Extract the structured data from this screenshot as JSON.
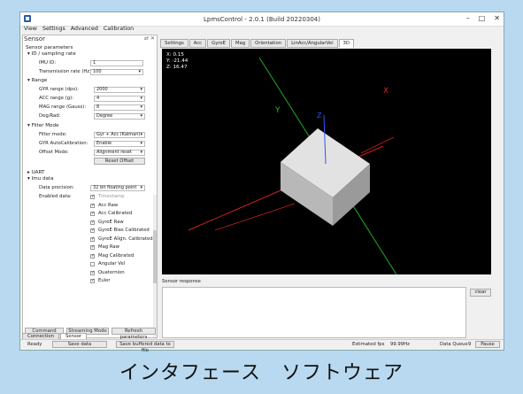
{
  "window": {
    "title": "LpmsControl - 2.0.1 (Build 20220304)"
  },
  "menu": [
    "View",
    "Settings",
    "Advanced",
    "Calibration"
  ],
  "sensor_panel": {
    "title": "Sensor",
    "header_buttons": "⇄ ✕",
    "root_label": "Sensor parameters",
    "id_section": "▾ ID / sampling rate",
    "imu_id_label": "IMU ID:",
    "imu_id_value": "1",
    "tx_rate_label": "Transmission rate (Hz):",
    "tx_rate_value": "100",
    "range_section": "▾ Range",
    "gyr_label": "GYR range (dps):",
    "gyr_value": "2000",
    "acc_label": "ACC range (g):",
    "acc_value": "4",
    "mag_label": "MAG range (Gauss):",
    "mag_value": "8",
    "deg_label": "Deg/Rad:",
    "deg_value": "Degree",
    "filter_section": "▾ Filter Mode",
    "filter_label": "Filter mode:",
    "filter_value": "Gyr + Acc (Kalman)",
    "gyr_auto_label": "GYR AutoCalibration:",
    "gyr_auto_value": "Enable",
    "offset_label": "Offset Mode:",
    "offset_value": "Alignment reset",
    "reset_offset": "Reset Offset",
    "uart_section": "▸ UART",
    "imu_data_section": "▾ Imu data",
    "precision_label": "Data precision:",
    "precision_value": "32 bit floating point",
    "enabled_label": "Enabled data:",
    "enabled_items": [
      {
        "label": "Timestamp",
        "checked": true,
        "dim": true
      },
      {
        "label": "Acc Raw",
        "checked": true
      },
      {
        "label": "Acc Calibrated",
        "checked": true
      },
      {
        "label": "GyroE Raw",
        "checked": true
      },
      {
        "label": "GyroE Bias Calibrated",
        "checked": true
      },
      {
        "label": "GyroE Align. Calibrated",
        "checked": true
      },
      {
        "label": "Mag Raw",
        "checked": true
      },
      {
        "label": "Mag Calibrated",
        "checked": true
      },
      {
        "label": "Angular Vel",
        "checked": false
      },
      {
        "label": "Quaternion",
        "checked": true
      },
      {
        "label": "Euler",
        "checked": true
      }
    ],
    "btn_command": "Command Mode",
    "btn_streaming": "Streaming Mode",
    "btn_refresh": "Refresh parameters"
  },
  "left_tabs": [
    "Connection",
    "Sensor"
  ],
  "top_tabs": [
    "Settings",
    "Acc",
    "GyroE",
    "Mag",
    "Orientation",
    "LinAcc/AngularVel",
    "3D"
  ],
  "viewport": {
    "x_label": "X: 0.15",
    "y_label": "Y: -21.44",
    "z_label": "Z: 16.47",
    "axis_x": "X",
    "axis_y": "Y",
    "axis_z": "Z",
    "color_x": "#e02020",
    "color_y": "#20c020",
    "color_z": "#3050ff"
  },
  "response": {
    "label": "Sensor response",
    "clear": "clear"
  },
  "status": {
    "ready": "Ready",
    "save_data": "Save data",
    "save_buffered": "Save buffered data to file",
    "fps_label": "Estimated fps",
    "fps_value": "99.99Hz",
    "queue_label": "Data Queue",
    "queue_value": "9",
    "pause": "Pause"
  },
  "caption": "インタフェース　ソフトウェア"
}
